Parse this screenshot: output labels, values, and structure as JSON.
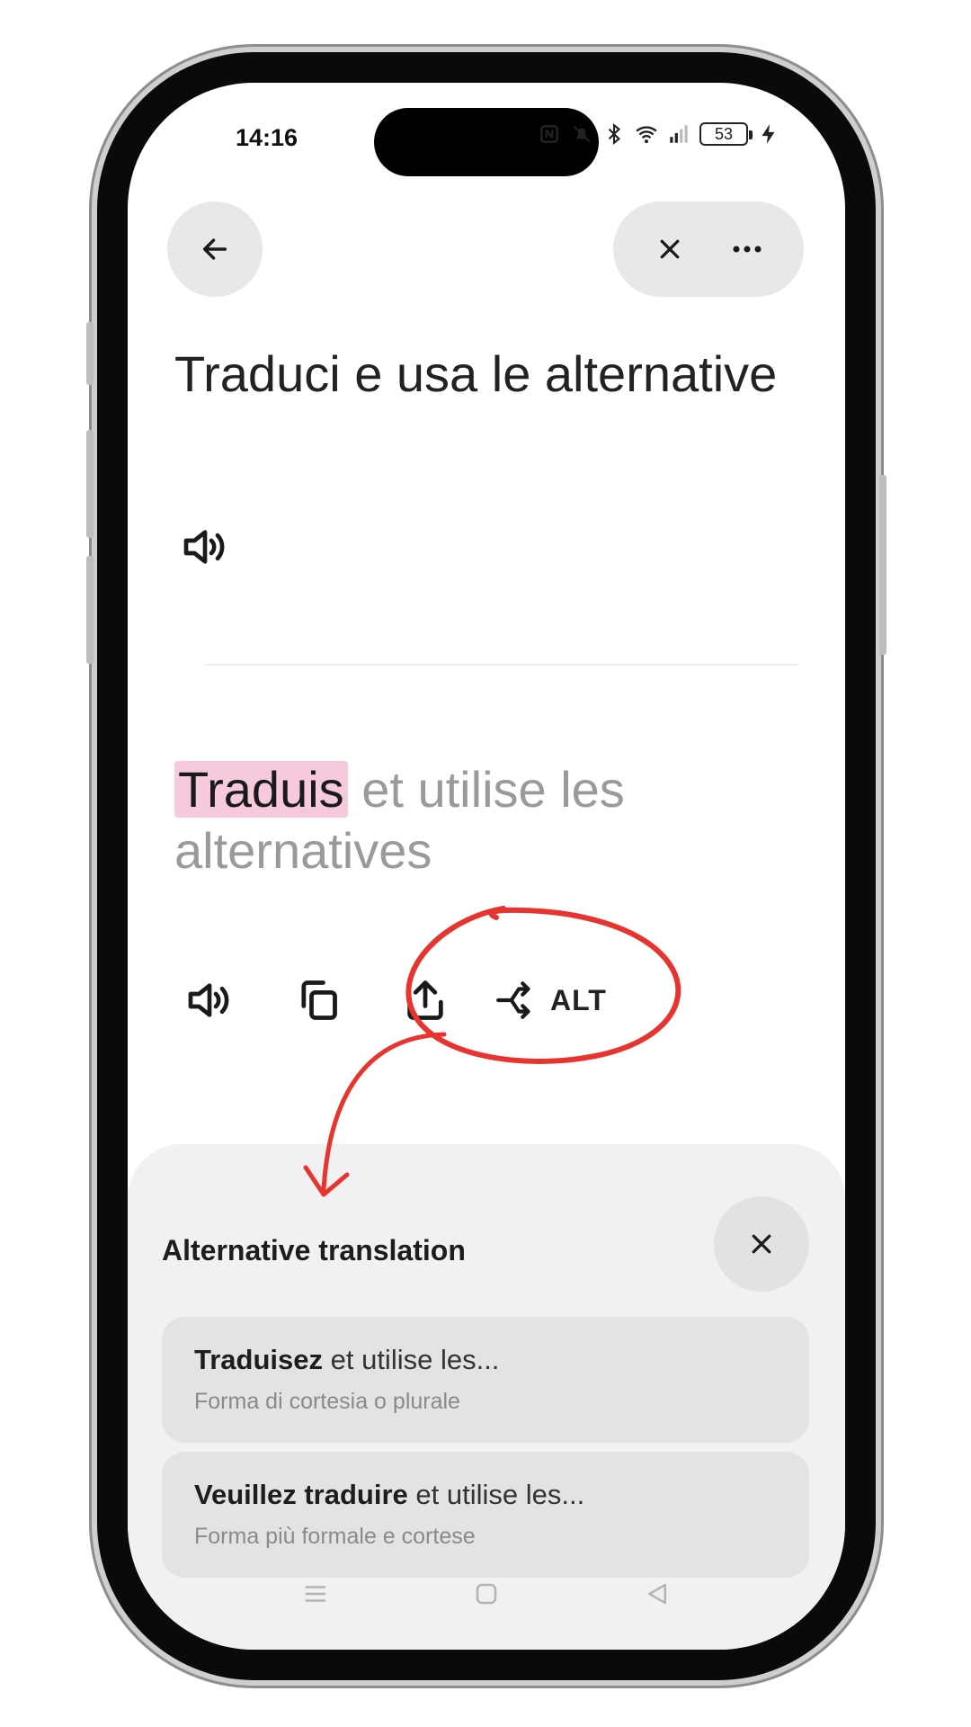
{
  "status_bar": {
    "time": "14:16",
    "battery": "53"
  },
  "source": {
    "text": "Traduci e usa le alternative"
  },
  "translation": {
    "highlighted": "Traduis",
    "rest": " et utilise les alternatives"
  },
  "actions": {
    "alt_label": "ALT"
  },
  "sheet": {
    "title": "Alternative translation",
    "options": [
      {
        "bold": "Traduisez",
        "rest": " et utilise les...",
        "sub": "Forma di cortesia o plurale"
      },
      {
        "bold": "Veuillez traduire",
        "rest": " et utilise les...",
        "sub": "Forma più formale e cortese"
      }
    ]
  },
  "colors": {
    "highlight": "#f7c9dd",
    "annotation": "#e8342e",
    "sheet_bg": "#f1f1f1"
  },
  "icons": [
    "back-arrow-icon",
    "close-icon",
    "more-icon",
    "speaker-icon",
    "copy-icon",
    "share-icon",
    "alt-branch-icon",
    "menu-icon",
    "home-icon",
    "back-nav-icon"
  ]
}
